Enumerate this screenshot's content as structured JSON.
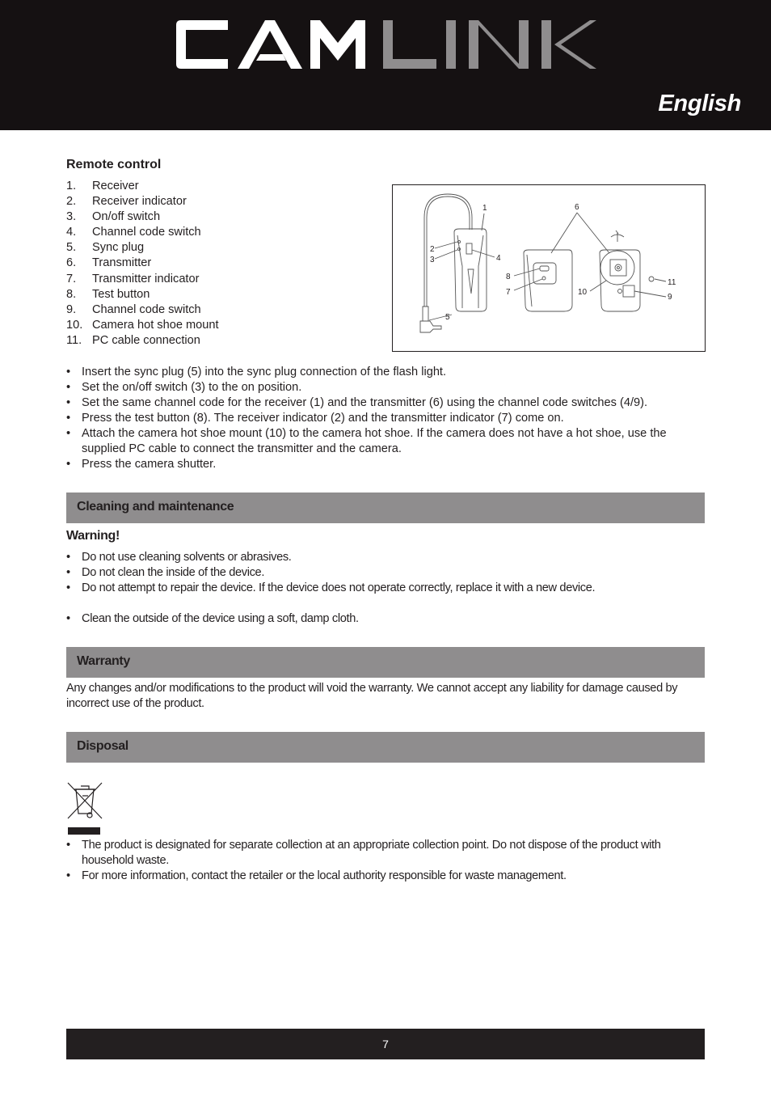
{
  "header": {
    "brand_part1": "CAM",
    "brand_part2": "LINK",
    "brand_colors": {
      "primary": "#ffffff",
      "secondary": "#8f8d8e",
      "background": "#151112"
    },
    "language": "English"
  },
  "remote_control": {
    "title": "Remote control",
    "parts": [
      {
        "num": "1.",
        "label": "Receiver"
      },
      {
        "num": "2.",
        "label": "Receiver indicator"
      },
      {
        "num": "3.",
        "label": "On/off switch"
      },
      {
        "num": "4.",
        "label": "Channel code switch"
      },
      {
        "num": "5.",
        "label": "Sync plug"
      },
      {
        "num": "6.",
        "label": "Transmitter"
      },
      {
        "num": "7.",
        "label": "Transmitter indicator"
      },
      {
        "num": "8.",
        "label": "Test button"
      },
      {
        "num": "9.",
        "label": "Channel code switch"
      },
      {
        "num": "10.",
        "label": "Camera hot shoe mount"
      },
      {
        "num": "11.",
        "label": "PC cable connection"
      }
    ],
    "figure_callouts": [
      "1",
      "2",
      "3",
      "4",
      "5",
      "6",
      "7",
      "8",
      "9",
      "10",
      "11"
    ],
    "instructions": [
      "Insert the sync plug (5) into the sync plug connection of the flash light.",
      "Set the on/off switch (3) to the on position.",
      "Set the same channel code for the receiver (1) and the transmitter (6) using the channel code switches (4/9).",
      "Press the test button (8). The receiver indicator (2) and the transmitter indicator (7) come on.",
      "Attach the camera hot shoe mount (10) to the camera hot shoe. If the camera does not have a hot shoe, use the supplied PC cable to connect the transmitter and the camera.",
      "Press the camera shutter."
    ]
  },
  "cleaning": {
    "title": "Cleaning and maintenance",
    "warning_label": "Warning!",
    "warnings": [
      "Do not use cleaning solvents or abrasives.",
      "Do not clean the inside of the device.",
      "Do not attempt to repair the device. If the device does not operate correctly, replace it with a new device."
    ],
    "tips": [
      "Clean the outside of the device using a soft, damp cloth."
    ]
  },
  "warranty": {
    "title": "Warranty",
    "text": "Any changes and/or modifications to the product will void the warranty. We cannot accept any liability for damage caused by incorrect use of the product."
  },
  "disposal": {
    "title": "Disposal",
    "icon": "weee-crossed-bin-icon",
    "items": [
      "The product is designated for separate collection at an appropriate collection point. Do not dispose of the product with household waste.",
      "For more information, contact the retailer or the local authority responsible for waste management."
    ]
  },
  "bullet_char": "•",
  "footer": {
    "page_number": "7"
  },
  "colors": {
    "band": "#8f8d8e",
    "text": "#231f20",
    "footer_bg": "#231f20"
  }
}
